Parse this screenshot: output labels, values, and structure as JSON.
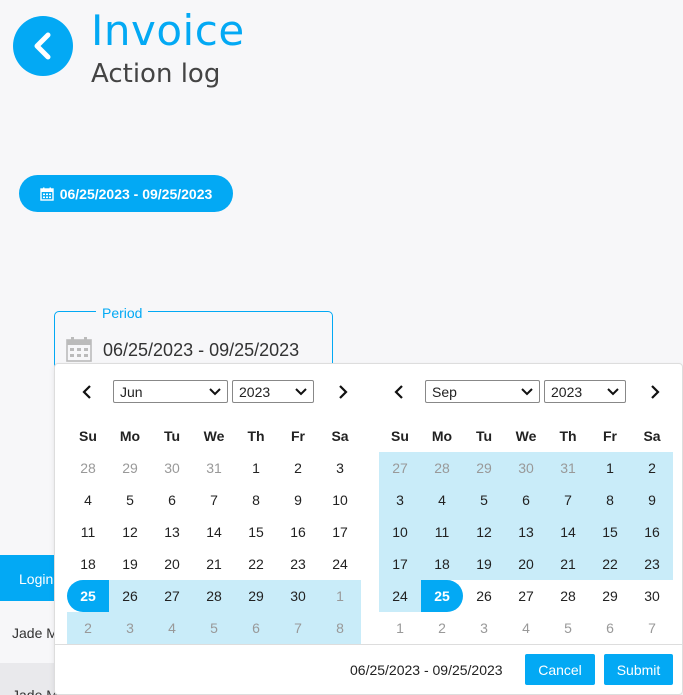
{
  "header": {
    "title": "Invoice",
    "subtitle": "Action log"
  },
  "range_pill": {
    "label": "06/25/2023 - 09/25/2023",
    "icon": "calendar-icon"
  },
  "period": {
    "label": "Period",
    "value": "06/25/2023 - 09/25/2023"
  },
  "table": {
    "header": "Login",
    "rows": [
      "Jade M",
      "Jade M"
    ]
  },
  "weekdays": [
    "Su",
    "Mo",
    "Tu",
    "We",
    "Th",
    "Fr",
    "Sa"
  ],
  "calendars": [
    {
      "month": "Jun",
      "year": "2023",
      "days": [
        {
          "d": "28",
          "off": true,
          "state": ""
        },
        {
          "d": "29",
          "off": true,
          "state": ""
        },
        {
          "d": "30",
          "off": true,
          "state": ""
        },
        {
          "d": "31",
          "off": true,
          "state": ""
        },
        {
          "d": "1",
          "off": false,
          "state": ""
        },
        {
          "d": "2",
          "off": false,
          "state": ""
        },
        {
          "d": "3",
          "off": false,
          "state": ""
        },
        {
          "d": "4",
          "off": false,
          "state": ""
        },
        {
          "d": "5",
          "off": false,
          "state": ""
        },
        {
          "d": "6",
          "off": false,
          "state": ""
        },
        {
          "d": "7",
          "off": false,
          "state": ""
        },
        {
          "d": "8",
          "off": false,
          "state": ""
        },
        {
          "d": "9",
          "off": false,
          "state": ""
        },
        {
          "d": "10",
          "off": false,
          "state": ""
        },
        {
          "d": "11",
          "off": false,
          "state": ""
        },
        {
          "d": "12",
          "off": false,
          "state": ""
        },
        {
          "d": "13",
          "off": false,
          "state": ""
        },
        {
          "d": "14",
          "off": false,
          "state": ""
        },
        {
          "d": "15",
          "off": false,
          "state": ""
        },
        {
          "d": "16",
          "off": false,
          "state": ""
        },
        {
          "d": "17",
          "off": false,
          "state": ""
        },
        {
          "d": "18",
          "off": false,
          "state": ""
        },
        {
          "d": "19",
          "off": false,
          "state": ""
        },
        {
          "d": "20",
          "off": false,
          "state": ""
        },
        {
          "d": "21",
          "off": false,
          "state": ""
        },
        {
          "d": "22",
          "off": false,
          "state": ""
        },
        {
          "d": "23",
          "off": false,
          "state": ""
        },
        {
          "d": "24",
          "off": false,
          "state": ""
        },
        {
          "d": "25",
          "off": false,
          "state": "start"
        },
        {
          "d": "26",
          "off": false,
          "state": "in"
        },
        {
          "d": "27",
          "off": false,
          "state": "in"
        },
        {
          "d": "28",
          "off": false,
          "state": "in"
        },
        {
          "d": "29",
          "off": false,
          "state": "in"
        },
        {
          "d": "30",
          "off": false,
          "state": "in"
        },
        {
          "d": "1",
          "off": true,
          "state": "in"
        },
        {
          "d": "2",
          "off": true,
          "state": "in"
        },
        {
          "d": "3",
          "off": true,
          "state": "in"
        },
        {
          "d": "4",
          "off": true,
          "state": "in"
        },
        {
          "d": "5",
          "off": true,
          "state": "in"
        },
        {
          "d": "6",
          "off": true,
          "state": "in"
        },
        {
          "d": "7",
          "off": true,
          "state": "in"
        },
        {
          "d": "8",
          "off": true,
          "state": "in"
        }
      ]
    },
    {
      "month": "Sep",
      "year": "2023",
      "days": [
        {
          "d": "27",
          "off": true,
          "state": "in"
        },
        {
          "d": "28",
          "off": true,
          "state": "in"
        },
        {
          "d": "29",
          "off": true,
          "state": "in"
        },
        {
          "d": "30",
          "off": true,
          "state": "in"
        },
        {
          "d": "31",
          "off": true,
          "state": "in"
        },
        {
          "d": "1",
          "off": false,
          "state": "in"
        },
        {
          "d": "2",
          "off": false,
          "state": "in"
        },
        {
          "d": "3",
          "off": false,
          "state": "in"
        },
        {
          "d": "4",
          "off": false,
          "state": "in"
        },
        {
          "d": "5",
          "off": false,
          "state": "in"
        },
        {
          "d": "6",
          "off": false,
          "state": "in"
        },
        {
          "d": "7",
          "off": false,
          "state": "in"
        },
        {
          "d": "8",
          "off": false,
          "state": "in"
        },
        {
          "d": "9",
          "off": false,
          "state": "in"
        },
        {
          "d": "10",
          "off": false,
          "state": "in"
        },
        {
          "d": "11",
          "off": false,
          "state": "in"
        },
        {
          "d": "12",
          "off": false,
          "state": "in"
        },
        {
          "d": "13",
          "off": false,
          "state": "in"
        },
        {
          "d": "14",
          "off": false,
          "state": "in"
        },
        {
          "d": "15",
          "off": false,
          "state": "in"
        },
        {
          "d": "16",
          "off": false,
          "state": "in"
        },
        {
          "d": "17",
          "off": false,
          "state": "in"
        },
        {
          "d": "18",
          "off": false,
          "state": "in"
        },
        {
          "d": "19",
          "off": false,
          "state": "in"
        },
        {
          "d": "20",
          "off": false,
          "state": "in"
        },
        {
          "d": "21",
          "off": false,
          "state": "in"
        },
        {
          "d": "22",
          "off": false,
          "state": "in"
        },
        {
          "d": "23",
          "off": false,
          "state": "in"
        },
        {
          "d": "24",
          "off": false,
          "state": "in"
        },
        {
          "d": "25",
          "off": false,
          "state": "end"
        },
        {
          "d": "26",
          "off": false,
          "state": ""
        },
        {
          "d": "27",
          "off": false,
          "state": ""
        },
        {
          "d": "28",
          "off": false,
          "state": ""
        },
        {
          "d": "29",
          "off": false,
          "state": ""
        },
        {
          "d": "30",
          "off": false,
          "state": ""
        },
        {
          "d": "1",
          "off": true,
          "state": ""
        },
        {
          "d": "2",
          "off": true,
          "state": ""
        },
        {
          "d": "3",
          "off": true,
          "state": ""
        },
        {
          "d": "4",
          "off": true,
          "state": ""
        },
        {
          "d": "5",
          "off": true,
          "state": ""
        },
        {
          "d": "6",
          "off": true,
          "state": ""
        },
        {
          "d": "7",
          "off": true,
          "state": ""
        }
      ]
    }
  ],
  "footer": {
    "range": "06/25/2023 - 09/25/2023",
    "cancel": "Cancel",
    "submit": "Submit"
  },
  "colors": {
    "accent": "#03a9f4",
    "range_fill": "#c9ecf9"
  }
}
